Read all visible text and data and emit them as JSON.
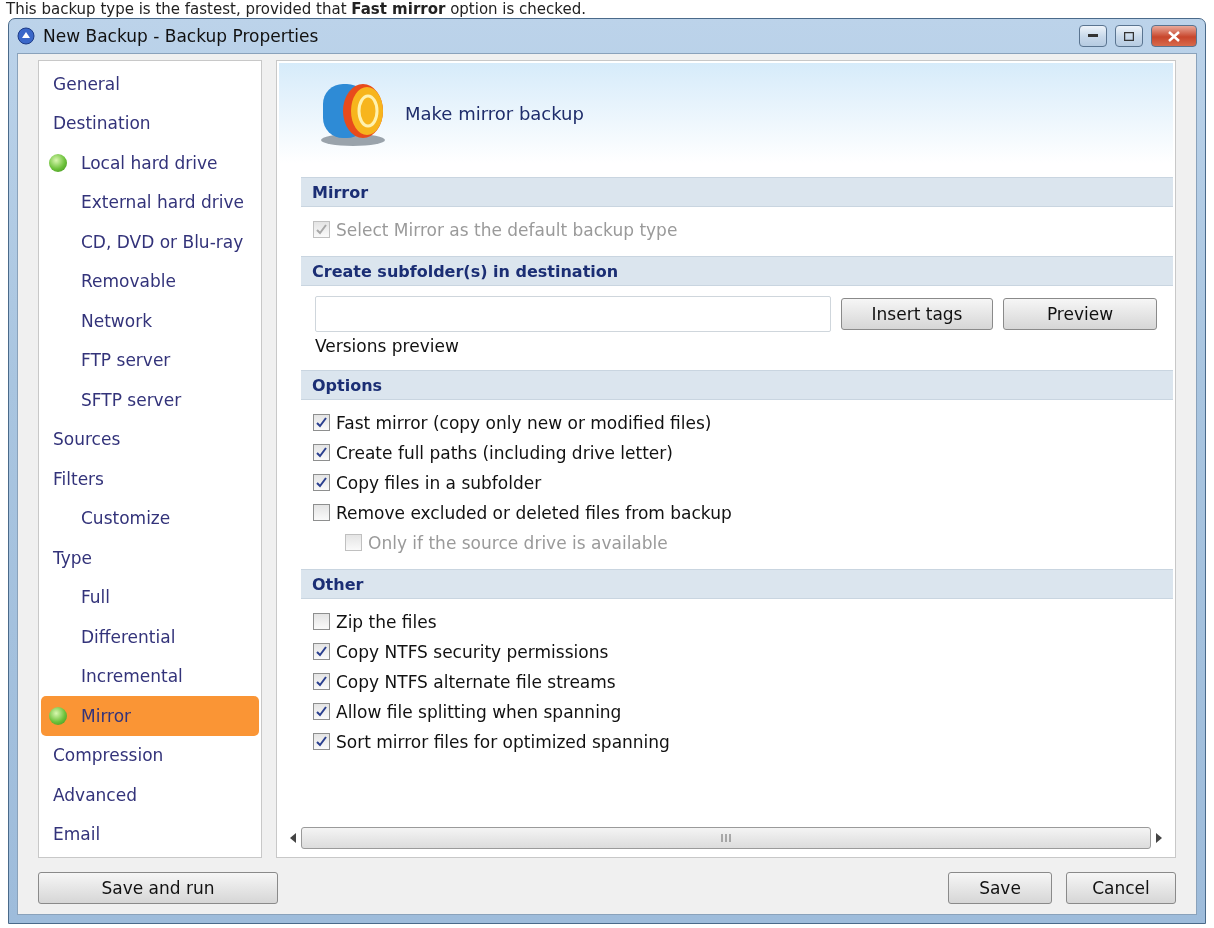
{
  "caption": "This backup type is the fastest, provided that **Fast mirror** option is checked.",
  "window": {
    "title": "New Backup - Backup Properties"
  },
  "sidebar": {
    "items": [
      {
        "label": "General",
        "selected": false,
        "indicator": false
      },
      {
        "label": "Destination",
        "selected": false,
        "indicator": false,
        "children": [
          {
            "label": "Local hard drive",
            "selected": false,
            "indicator": true
          },
          {
            "label": "External hard drive",
            "selected": false,
            "indicator": false
          },
          {
            "label": "CD, DVD or Blu-ray",
            "selected": false,
            "indicator": false
          },
          {
            "label": "Removable",
            "selected": false,
            "indicator": false
          },
          {
            "label": "Network",
            "selected": false,
            "indicator": false
          },
          {
            "label": "FTP server",
            "selected": false,
            "indicator": false
          },
          {
            "label": "SFTP server",
            "selected": false,
            "indicator": false
          }
        ]
      },
      {
        "label": "Sources",
        "selected": false,
        "indicator": false
      },
      {
        "label": "Filters",
        "selected": false,
        "indicator": false,
        "children": [
          {
            "label": "Customize",
            "selected": false,
            "indicator": false
          }
        ]
      },
      {
        "label": "Type",
        "selected": false,
        "indicator": false,
        "children": [
          {
            "label": "Full",
            "selected": false,
            "indicator": false
          },
          {
            "label": "Differential",
            "selected": false,
            "indicator": false
          },
          {
            "label": "Incremental",
            "selected": false,
            "indicator": false
          },
          {
            "label": "Mirror",
            "selected": true,
            "indicator": true
          }
        ]
      },
      {
        "label": "Compression",
        "selected": false,
        "indicator": false
      },
      {
        "label": "Advanced",
        "selected": false,
        "indicator": false
      },
      {
        "label": "Email",
        "selected": false,
        "indicator": false
      }
    ]
  },
  "panel": {
    "heading": "Make mirror backup",
    "sections": [
      {
        "title": "Mirror",
        "kind": "checks",
        "options": [
          {
            "label": "Select Mirror as the default backup type",
            "checked": true,
            "disabled": true
          }
        ]
      },
      {
        "title": "Create subfolder(s) in destination",
        "kind": "subfolder",
        "buttons": [
          "Insert tags",
          "Preview"
        ],
        "note": "Versions preview"
      },
      {
        "title": "Options",
        "kind": "checks",
        "options": [
          {
            "label": "Fast mirror (copy only new or modified files)",
            "checked": true,
            "disabled": false
          },
          {
            "label": "Create full paths (including drive letter)",
            "checked": true,
            "disabled": false
          },
          {
            "label": "Copy files in a subfolder",
            "checked": true,
            "disabled": false
          },
          {
            "label": "Remove excluded or deleted files from backup",
            "checked": false,
            "disabled": false,
            "children": [
              {
                "label": "Only if the source drive is available",
                "checked": false,
                "disabled": true
              }
            ]
          }
        ]
      },
      {
        "title": "Other",
        "kind": "checks",
        "options": [
          {
            "label": "Zip the files",
            "checked": false,
            "disabled": false
          },
          {
            "label": "Copy NTFS security permissions",
            "checked": true,
            "disabled": false
          },
          {
            "label": "Copy NTFS alternate file streams",
            "checked": true,
            "disabled": false
          },
          {
            "label": "Allow file splitting when spanning",
            "checked": true,
            "disabled": false
          },
          {
            "label": "Sort mirror files for optimized spanning",
            "checked": true,
            "disabled": false
          }
        ]
      }
    ]
  },
  "footer": {
    "left_button": "Save and run",
    "buttons": [
      "Save",
      "Cancel"
    ]
  }
}
